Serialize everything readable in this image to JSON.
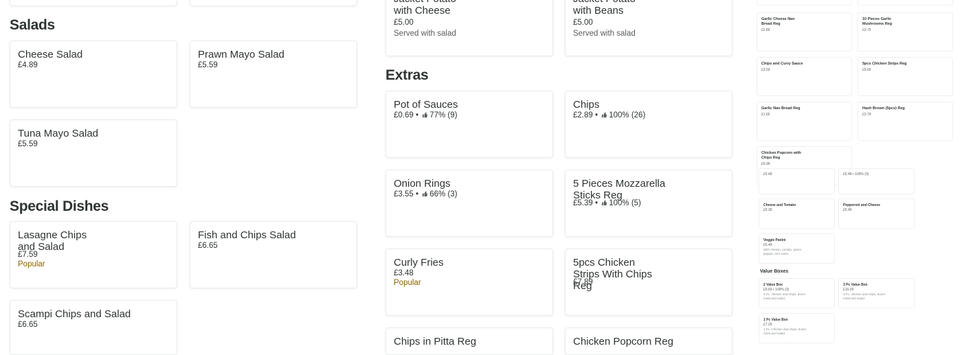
{
  "sections": {
    "salads": "Salads",
    "special": "Special Dishes",
    "extras": "Extras"
  },
  "col1": {
    "cheese_salad": {
      "title": "Cheese Salad",
      "price": "£4.89"
    },
    "prawn_salad": {
      "title": "Prawn Mayo Salad",
      "price": "£5.59"
    },
    "tuna_salad": {
      "title": "Tuna Mayo Salad",
      "price": "£5.59"
    },
    "lasagne": {
      "title": "Lasagne Chips and Salad",
      "price": "£7.59",
      "tag": "Popular"
    },
    "fish": {
      "title": "Fish and Chips Salad",
      "price": "£6.65"
    },
    "scampi": {
      "title": "Scampi Chips and Salad",
      "price": "£6.65"
    }
  },
  "col2": {
    "jacket_cheese": {
      "title": "Jacket Potato with Cheese",
      "price": "£5.00",
      "desc": "Served with salad"
    },
    "jacket_beans": {
      "title": "Jacket Potato with Beans",
      "price": "£5.00",
      "desc": "Served with salad"
    },
    "pot_sauces": {
      "title": "Pot of Sauces",
      "price": "£0.69",
      "rating": "77% (9)"
    },
    "chips": {
      "title": "Chips",
      "price": "£2.89",
      "rating": "100% (26)"
    },
    "onion_rings": {
      "title": "Onion Rings",
      "price": "£3.55",
      "rating": "66% (3)"
    },
    "mozzarella": {
      "title": "5 Pieces Mozzarella Sticks Reg",
      "price": "£5.39",
      "rating": "100% (5)"
    },
    "curly_fries": {
      "title": "Curly Fries",
      "price": "£3.48",
      "tag": "Popular"
    },
    "chicken_strips": {
      "title": "5pcs Chicken Strips With Chips Reg",
      "price": "£7.89"
    },
    "chips_pitta": {
      "title": "Chips in Pitta Reg"
    },
    "popcorn": {
      "title": "Chicken Popcorn Reg"
    },
    "bullet": "•"
  },
  "sidebar": {
    "garlic_cheese_nan": {
      "title": "Garlic Cheese Nan Bread Reg",
      "price": "£2.89"
    },
    "garlic_mushrooms": {
      "title": "10 Pieces Garlic Mushrooms Reg",
      "price": "£3.75"
    },
    "chips_curry": {
      "title": "Chips and Curry Sauce",
      "price": "£3.59"
    },
    "chicken_strips_reg": {
      "title": "5pcs Chicken Strips Reg",
      "price": "£5.69"
    },
    "garlic_nan": {
      "title": "Garlic Nan Bread Reg",
      "price": "£1.65"
    },
    "hash_brown": {
      "title": "Hash Brown (5pcs) Reg",
      "price": "£3.79"
    },
    "popcorn_chips": {
      "title": "Chicken Popcorn with Chips Reg",
      "price": "£6.99"
    },
    "mini_a": {
      "price": "£5.49"
    },
    "mini_b": {
      "price": "£5.49 • 100% (3)"
    },
    "cheese_tomato": {
      "title": "Cheese and Tomato",
      "price": "£5.39"
    },
    "pepperoni": {
      "title": "Pepperoni and Cheese",
      "price": "£5.49"
    },
    "veggie_panini": {
      "title": "Veggie Panini",
      "price": "£5.49",
      "desc": "With cheese, tomato, green pepper, and onion."
    },
    "value_boxes": "Value Boxes",
    "box2": {
      "title": "2 Value Box",
      "price": "£9.69 • 100% (3)",
      "desc": "2 Pc. chicken and chips, doner meat and salad."
    },
    "box3": {
      "title": "3 Pc Value Box",
      "price": "£10.29",
      "desc": "3 Pc. chicken and chips, doner meat and salad."
    },
    "box1": {
      "title": "1 Pc Value Box",
      "price": "£7.29",
      "desc": "1 Pc. Chicken and chips, doner meat and salad."
    }
  },
  "colors": {
    "text": "#2e3333",
    "border": "#e8ebeb",
    "popular": "#8a6200"
  },
  "icons": {
    "rating": "thumbs-up-icon"
  }
}
